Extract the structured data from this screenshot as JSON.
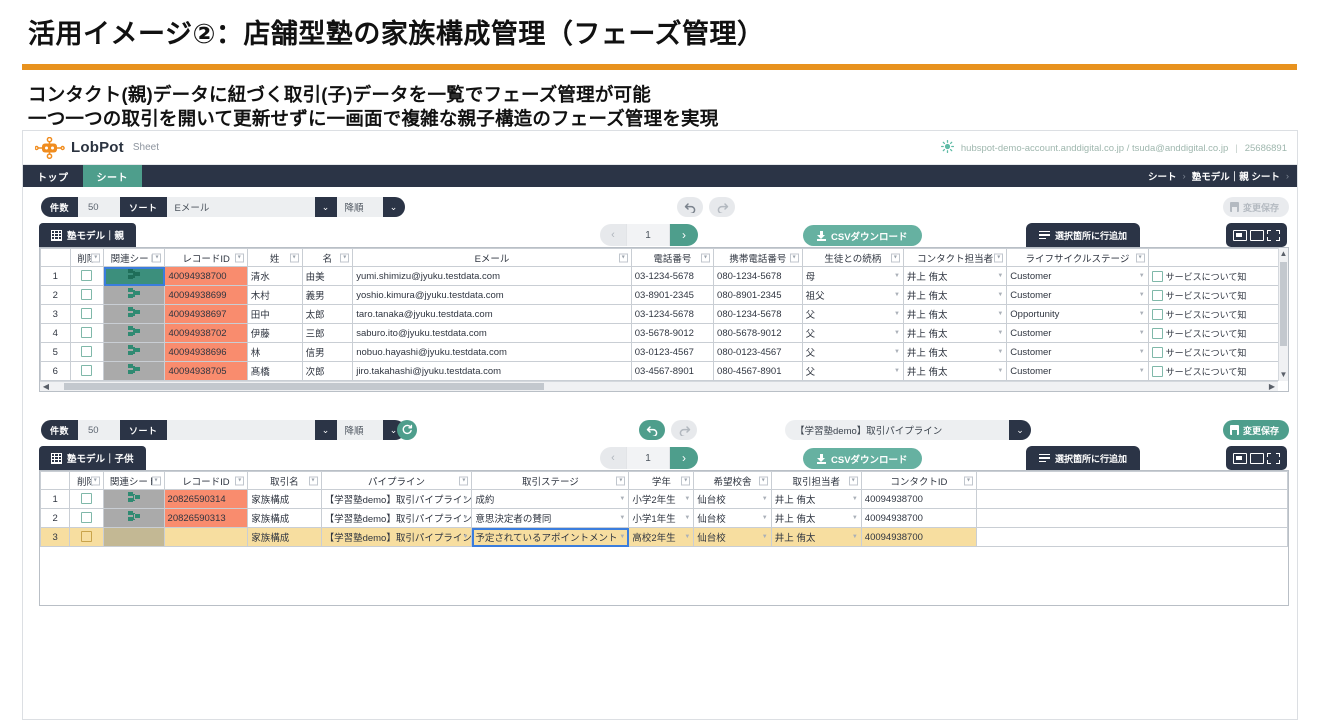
{
  "slide": {
    "title": "活用イメージ②：店舗型塾の家族構成管理（フェーズ管理）",
    "lead1": "コンタクト(親)データに紐づく取引(子)データを一覧でフェーズ管理が可能",
    "lead2": "一つ一つの取引を開いて更新せずに一画面で複雑な親子構造のフェーズ管理を実現",
    "accent": "#E8921E"
  },
  "app": {
    "logo_text": "LobPot",
    "logo_sub": "Sheet",
    "account": "hubspot-demo-account.anddigital.co.jp / tsuda@anddigital.co.jp",
    "account_sep": "|",
    "account_id": "25686891",
    "nav": [
      {
        "label": "トップ",
        "active": false
      },
      {
        "label": "シート",
        "active": true
      }
    ],
    "breadcrumb": {
      "root": "シート",
      "chev": "›",
      "current": "塾モデル｜親 シート",
      "chev2": "›"
    }
  },
  "parent_sheet": {
    "toolbar": {
      "count_label": "件数",
      "count_value": "50",
      "sort_label": "ソート",
      "sort_value": "Eメール",
      "order_value": "降順",
      "caret": "⌄",
      "undo_icon": "undo-arrow",
      "redo_icon": "redo-arrow",
      "save_label": "変更保存"
    },
    "tab_label": "塾モデル｜親",
    "pager": {
      "prev": "‹",
      "page": "1",
      "next": "›"
    },
    "csv_label": "CSVダウンロード",
    "addrow_label": "選択箇所に行追加",
    "headers": [
      "",
      "削除",
      "関連シート",
      "レコードID",
      "姓",
      "名",
      "Eメール",
      "電話番号",
      "携帯電話番号",
      "生徒との続柄",
      "コンタクト担当者",
      "ライフサイクルステージ",
      ""
    ],
    "rows": [
      {
        "num": "1",
        "record_id": "40094938700",
        "last_name": "清水",
        "first_name": "由美",
        "email": "yumi.shimizu@jyuku.testdata.com",
        "phone": "03-1234-5678",
        "mobile": "080-1234-5678",
        "relation": "母",
        "owner": "井上 侑太",
        "lifecycle": "Customer",
        "last": "サービスについて知",
        "selected": true
      },
      {
        "num": "2",
        "record_id": "40094938699",
        "last_name": "木村",
        "first_name": "義男",
        "email": "yoshio.kimura@jyuku.testdata.com",
        "phone": "03-8901-2345",
        "mobile": "080-8901-2345",
        "relation": "祖父",
        "owner": "井上 侑太",
        "lifecycle": "Customer",
        "last": "サービスについて知",
        "selected": false
      },
      {
        "num": "3",
        "record_id": "40094938697",
        "last_name": "田中",
        "first_name": "太郎",
        "email": "taro.tanaka@jyuku.testdata.com",
        "phone": "03-1234-5678",
        "mobile": "080-1234-5678",
        "relation": "父",
        "owner": "井上 侑太",
        "lifecycle": "Opportunity",
        "last": "サービスについて知",
        "selected": false
      },
      {
        "num": "4",
        "record_id": "40094938702",
        "last_name": "伊藤",
        "first_name": "三郎",
        "email": "saburo.ito@jyuku.testdata.com",
        "phone": "03-5678-9012",
        "mobile": "080-5678-9012",
        "relation": "父",
        "owner": "井上 侑太",
        "lifecycle": "Customer",
        "last": "サービスについて知",
        "selected": false
      },
      {
        "num": "5",
        "record_id": "40094938696",
        "last_name": "林",
        "first_name": "信男",
        "email": "nobuo.hayashi@jyuku.testdata.com",
        "phone": "03-0123-4567",
        "mobile": "080-0123-4567",
        "relation": "父",
        "owner": "井上 侑太",
        "lifecycle": "Customer",
        "last": "サービスについて知",
        "selected": false
      },
      {
        "num": "6",
        "record_id": "40094938705",
        "last_name": "髙橋",
        "first_name": "次郎",
        "email": "jiro.takahashi@jyuku.testdata.com",
        "phone": "03-4567-8901",
        "mobile": "080-4567-8901",
        "relation": "父",
        "owner": "井上 侑太",
        "lifecycle": "Customer",
        "last": "サービスについて知",
        "selected": false
      }
    ]
  },
  "child_sheet": {
    "toolbar": {
      "count_label": "件数",
      "count_value": "50",
      "sort_label": "ソート",
      "sort_value": "",
      "order_value": "降順",
      "caret": "⌄",
      "refresh_icon": "refresh-icon",
      "undo_icon": "undo-arrow",
      "redo_icon": "redo-arrow",
      "pipeline_value": "【学習塾demo】取引パイプライン",
      "save_label": "変更保存"
    },
    "tab_label": "塾モデル｜子供",
    "pager": {
      "prev": "‹",
      "page": "1",
      "next": "›"
    },
    "csv_label": "CSVダウンロード",
    "addrow_label": "選択箇所に行追加",
    "headers": [
      "",
      "削除",
      "関連シート",
      "レコードID",
      "取引名",
      "パイプライン",
      "取引ステージ",
      "学年",
      "希望校舎",
      "取引担当者",
      "コンタクトID"
    ],
    "rows": [
      {
        "num": "1",
        "record_id": "20826590314",
        "deal_name": "家族構成",
        "pipeline": "【学習塾demo】取引パイプライン",
        "stage": "成約",
        "grade": "小学2年生",
        "campus": "仙台校",
        "owner": "井上 侑太",
        "contact_id": "40094938700",
        "is_new": false,
        "focused": false
      },
      {
        "num": "2",
        "record_id": "20826590313",
        "deal_name": "家族構成",
        "pipeline": "【学習塾demo】取引パイプライン",
        "stage": "意思決定者の賛同",
        "grade": "小学1年生",
        "campus": "仙台校",
        "owner": "井上 侑太",
        "contact_id": "40094938700",
        "is_new": false,
        "focused": false
      },
      {
        "num": "3",
        "record_id": "",
        "deal_name": "家族構成",
        "pipeline": "【学習塾demo】取引パイプライン",
        "stage": "予定されているアポイントメント",
        "grade": "高校2年生",
        "campus": "仙台校",
        "owner": "井上 侑太",
        "contact_id": "40094938700",
        "is_new": true,
        "focused": true
      }
    ]
  }
}
